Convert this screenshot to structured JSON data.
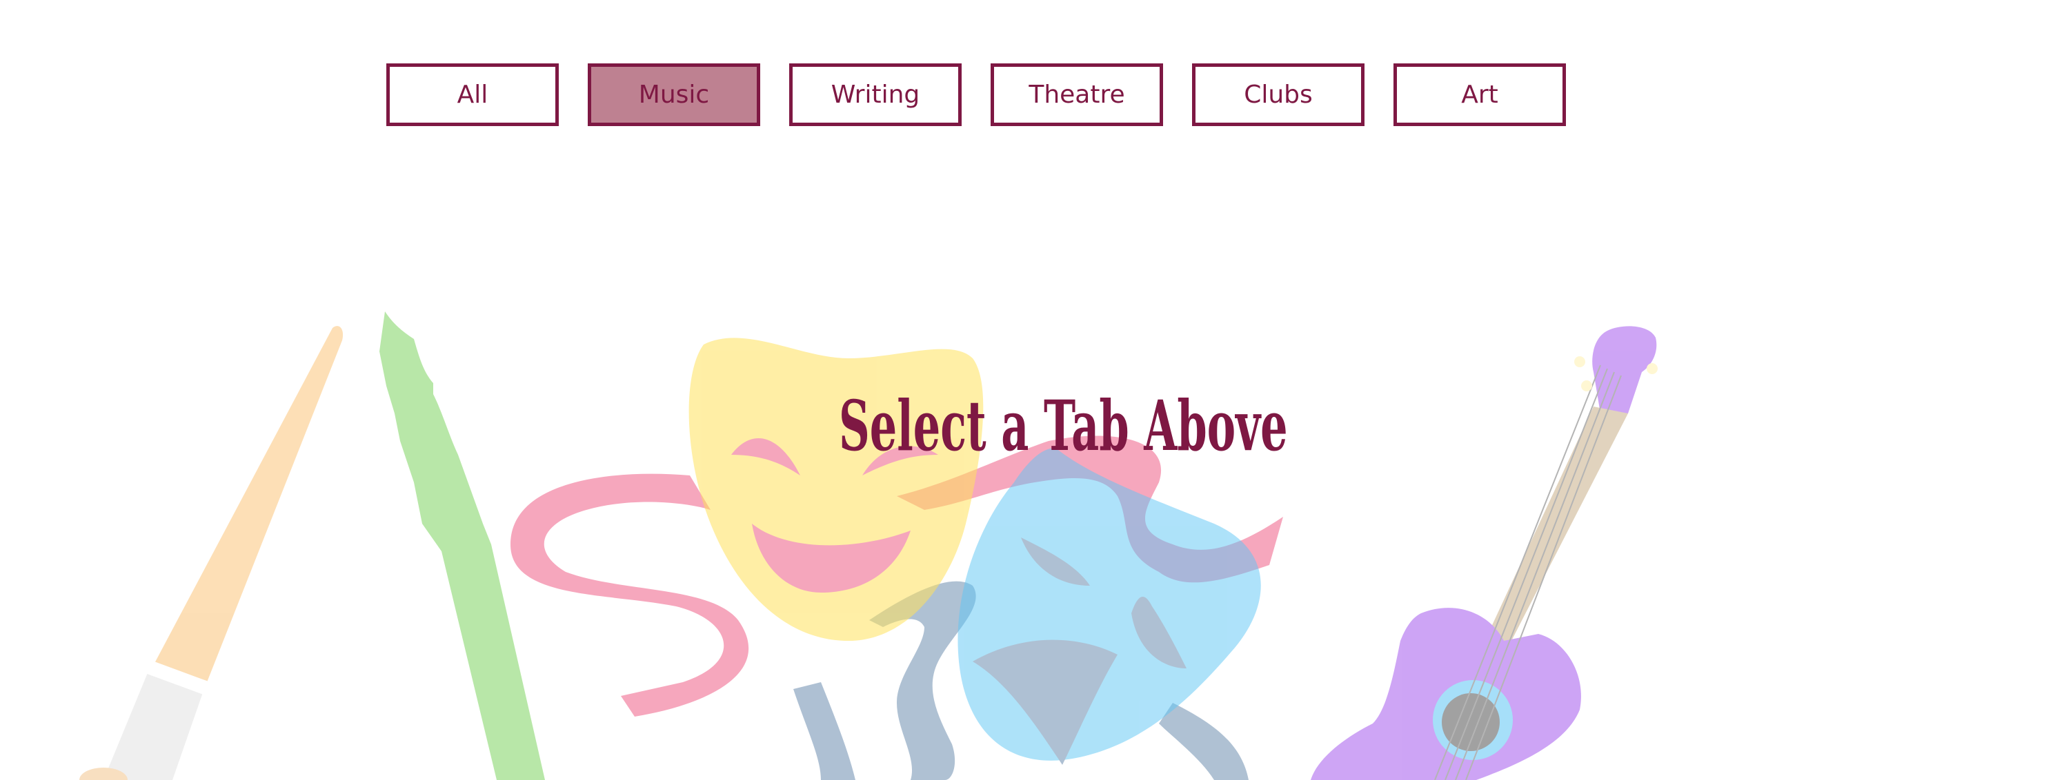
{
  "tabs": [
    {
      "label": "All",
      "active": false
    },
    {
      "label": "Music",
      "active": true
    },
    {
      "label": "Writing",
      "active": false
    },
    {
      "label": "Theatre",
      "active": false
    },
    {
      "label": "Clubs",
      "active": false
    },
    {
      "label": "Art",
      "active": false
    }
  ],
  "main": {
    "heading": "Select a Tab Above"
  },
  "colors": {
    "accent": "#7e1843",
    "active_tab_fill": "#be8191"
  },
  "illustration": {
    "icons": [
      "paintbrush-icon",
      "pen-nib-icon",
      "theatre-masks-icon",
      "ribbon-icon",
      "guitar-icon"
    ]
  }
}
